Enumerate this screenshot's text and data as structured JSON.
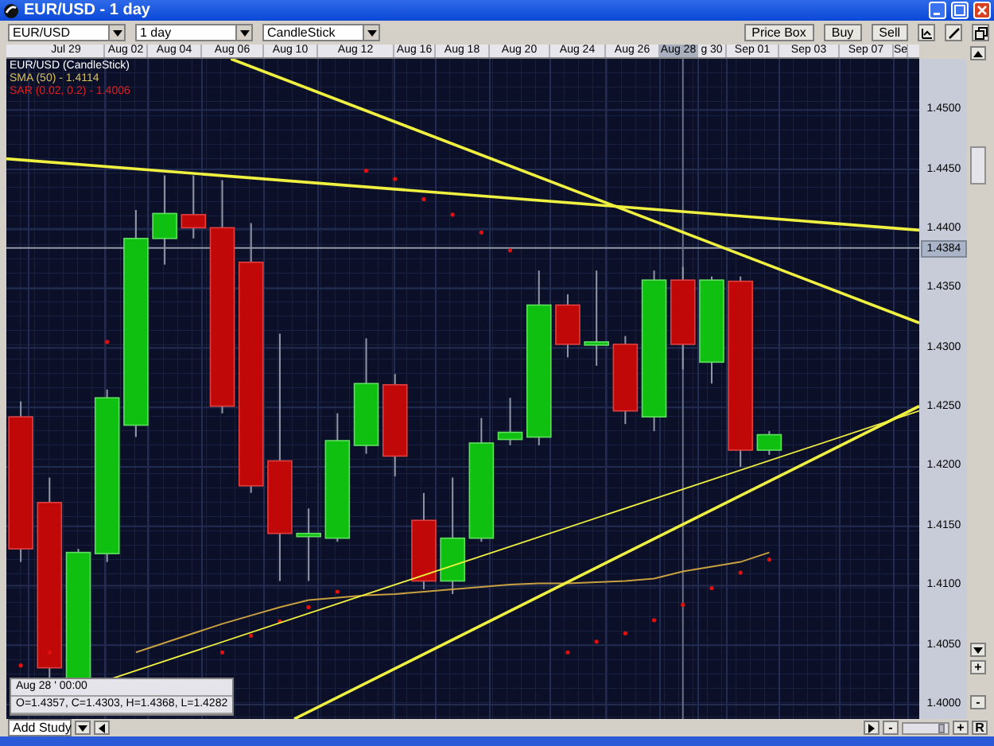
{
  "window": {
    "title": "EUR/USD - 1 day"
  },
  "toolbar": {
    "dropdowns": [
      "EUR/USD",
      "1 day",
      "CandleStick"
    ],
    "buttons": [
      "Price Box",
      "Buy",
      "Sell"
    ]
  },
  "chart": {
    "date_labels": [
      {
        "label": "Jul 29",
        "selected": false
      },
      {
        "label": "Aug 02",
        "selected": false
      },
      {
        "label": "Aug 04",
        "selected": false
      },
      {
        "label": "Aug 06",
        "selected": false
      },
      {
        "label": "Aug 10",
        "selected": false
      },
      {
        "label": "Aug 12",
        "selected": false
      },
      {
        "label": "Aug 16",
        "selected": false
      },
      {
        "label": "Aug 18",
        "selected": false
      },
      {
        "label": "Aug 20",
        "selected": false
      },
      {
        "label": "Aug 24",
        "selected": false
      },
      {
        "label": "Aug 26",
        "selected": false
      },
      {
        "label": "Aug 28",
        "selected": true
      },
      {
        "label": "g 30",
        "selected": false
      },
      {
        "label": "Sep 01",
        "selected": false
      },
      {
        "label": "Sep 03",
        "selected": false
      },
      {
        "label": "Sep 07",
        "selected": false
      },
      {
        "label": "Se",
        "selected": false
      }
    ],
    "legend": [
      {
        "kind": "main",
        "text": "EUR/USD (CandleStick)"
      },
      {
        "kind": "sma",
        "text": "SMA (50) - 1.4114"
      },
      {
        "kind": "sar",
        "text": "SAR (0.02, 0.2) - 1.4006"
      }
    ],
    "tooltip": {
      "title": "Aug 28 ' 00:00",
      "values": "O=1.4357, C=1.4303, H=1.4368, L=1.4282"
    }
  },
  "price_axis": {
    "labels": [
      "1.4500",
      "1.4450",
      "1.4400",
      "1.4350",
      "1.4300",
      "1.4250",
      "1.4200",
      "1.4150",
      "1.4100",
      "1.4050",
      "1.4000"
    ],
    "current_price": "1.4384",
    "zoom_in": "+",
    "zoom_out": "-"
  },
  "bottom_bar": {
    "study_dropdown": "Add Study",
    "zoom_out": "-",
    "zoom_slider": {
      "level": 0.9
    },
    "zoom_in": "+",
    "reset": "R"
  }
}
